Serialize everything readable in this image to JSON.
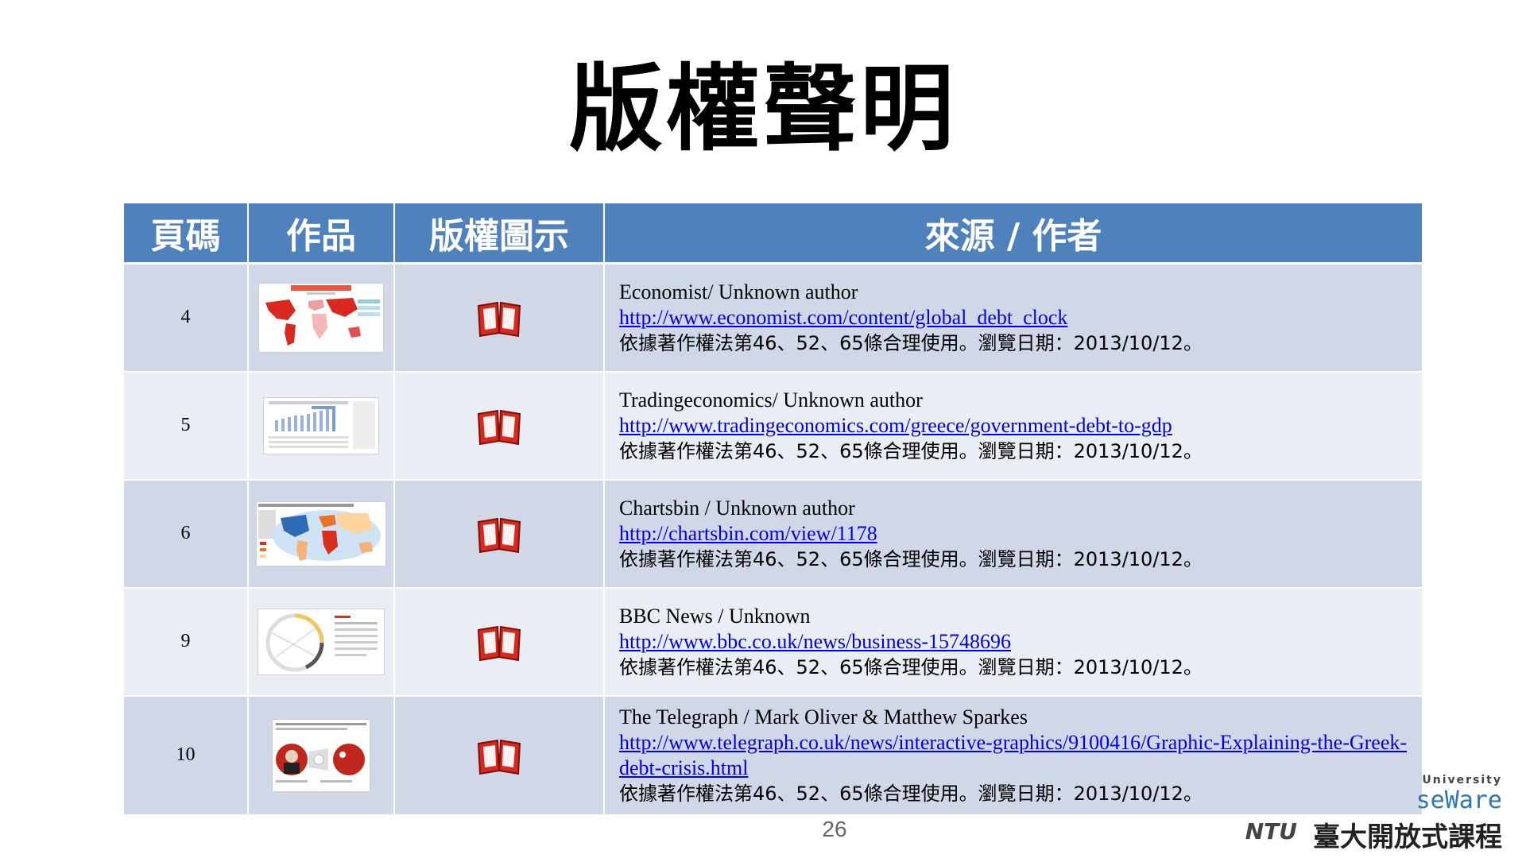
{
  "title": "版權聲明",
  "table": {
    "headers": [
      "頁碼",
      "作品",
      "版權圖示",
      "來源 / 作者"
    ],
    "rows": [
      {
        "page": "4",
        "source": "Economist/ Unknown  author",
        "url": "http://www.economist.com/content/global_debt_clock",
        "cite": "依據著作權法第46、52、65條合理使用。瀏覽日期：2013/10/12。"
      },
      {
        "page": "5",
        "source": "Tradingeconomics/ Unknown author",
        "url": "http://www.tradingeconomics.com/greece/government-debt-to-gdp",
        "cite": "依據著作權法第46、52、65條合理使用。瀏覽日期：2013/10/12。"
      },
      {
        "page": "6",
        "source": "Chartsbin / Unknown author",
        "url": "http://chartsbin.com/view/1178",
        "cite": "依據著作權法第46、52、65條合理使用。瀏覽日期：2013/10/12。"
      },
      {
        "page": "9",
        "source": "BBC News / Unknown",
        "url": "http://www.bbc.co.uk/news/business-15748696",
        "cite": "依據著作權法第46、52、65條合理使用。瀏覽日期：2013/10/12。"
      },
      {
        "page": "10",
        "source": "The Telegraph / Mark Oliver & Matthew Sparkes",
        "url": "http://www.telegraph.co.uk/news/interactive-graphics/9100416/Graphic-Explaining-the-Greek-debt-crisis.html",
        "cite": "依據著作權法第46、52、65條合理使用。瀏覽日期：2013/10/12。"
      }
    ]
  },
  "icons": {
    "license": "book-icon"
  },
  "colors": {
    "header_bg": "#4f81bd",
    "row_odd": "#d0d8e8",
    "row_even": "#e9edf4",
    "link": "#0000ee",
    "icon_red": "#d9281e"
  },
  "page_number": "26",
  "logo": {
    "line1": "University",
    "line2": "seWare",
    "line3": "臺大開放式課程",
    "mark": "NTU"
  }
}
